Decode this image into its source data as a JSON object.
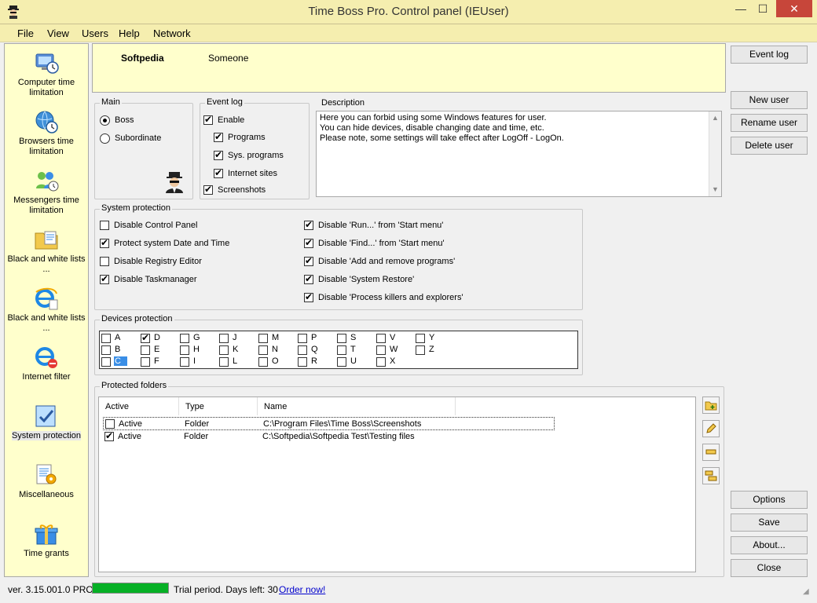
{
  "window": {
    "title": "Time Boss Pro. Control panel (IEUser)"
  },
  "menu": [
    "File",
    "View",
    "Users",
    "Help",
    "Network"
  ],
  "nav": [
    {
      "label": "Computer time limitation",
      "icon": "computer-clock-icon"
    },
    {
      "label": "Browsers time limitation",
      "icon": "globe-clock-icon"
    },
    {
      "label": "Messengers time limitation",
      "icon": "messenger-icon"
    },
    {
      "label": "Black and white lists ...",
      "icon": "folder-list-icon"
    },
    {
      "label": "Black and white lists ...",
      "icon": "ie-list-icon"
    },
    {
      "label": "Internet filter",
      "icon": "ie-filter-icon"
    },
    {
      "label": "System protection",
      "icon": "system-protection-icon"
    },
    {
      "label": "Miscellaneous",
      "icon": "gear-document-icon"
    },
    {
      "label": "Time grants",
      "icon": "gift-icon"
    }
  ],
  "user": {
    "login": "Softpedia",
    "name": "Someone"
  },
  "main": {
    "title": "Main",
    "options": [
      "Boss",
      "Subordinate"
    ],
    "selected": "Boss"
  },
  "eventlog": {
    "title": "Event log",
    "items": [
      {
        "label": "Enable",
        "checked": true
      },
      {
        "label": "Programs",
        "checked": true
      },
      {
        "label": "Sys. programs",
        "checked": true
      },
      {
        "label": "Internet sites",
        "checked": true
      },
      {
        "label": "Screenshots",
        "checked": true
      }
    ]
  },
  "description": {
    "title": "Description",
    "lines": [
      "Here you can forbid using some Windows features for user.",
      "You can hide devices, disable changing date and time, etc.",
      "Please note, some settings will take effect after LogOff - LogOn."
    ]
  },
  "sysprot": {
    "title": "System protection",
    "left": [
      {
        "label": "Disable Control Panel",
        "checked": false
      },
      {
        "label": "Protect system Date and Time",
        "checked": true
      },
      {
        "label": "Disable Registry Editor",
        "checked": false
      },
      {
        "label": "Disable Taskmanager",
        "checked": true
      }
    ],
    "right": [
      {
        "label": "Disable 'Run...' from 'Start menu'",
        "checked": true
      },
      {
        "label": "Disable 'Find...' from 'Start menu'",
        "checked": true
      },
      {
        "label": "Disable 'Add and remove programs'",
        "checked": true
      },
      {
        "label": "Disable 'System Restore'",
        "checked": true
      },
      {
        "label": "Disable 'Process killers and explorers'",
        "checked": true
      }
    ]
  },
  "devices": {
    "title": "Devices protection",
    "columns": [
      [
        "A",
        "B",
        "C"
      ],
      [
        "D",
        "E",
        "F"
      ],
      [
        "G",
        "H",
        "I"
      ],
      [
        "J",
        "K",
        "L"
      ],
      [
        "M",
        "N",
        "O"
      ],
      [
        "P",
        "Q",
        "R"
      ],
      [
        "S",
        "T",
        "U"
      ],
      [
        "V",
        "W",
        "X"
      ],
      [
        "Y",
        "Z"
      ]
    ],
    "checked": [
      "D"
    ],
    "selected": "C"
  },
  "folders": {
    "title": "Protected folders",
    "headers": [
      "Active",
      "Type",
      "Name"
    ],
    "rows": [
      {
        "active": false,
        "status": "Active",
        "type": "Folder",
        "name": "C:\\Program Files\\Time Boss\\Screenshots"
      },
      {
        "active": true,
        "status": "Active",
        "type": "Folder",
        "name": "C:\\Softpedia\\Softpedia Test\\Testing files"
      }
    ],
    "tools": [
      "add-folder-icon",
      "edit-pencil-icon",
      "remove-icon",
      "move-icon"
    ]
  },
  "buttons": {
    "event_log": "Event log",
    "new_user": "New user",
    "rename_user": "Rename user",
    "delete_user": "Delete user",
    "options": "Options",
    "save": "Save",
    "about": "About...",
    "close": "Close"
  },
  "status": {
    "version": "ver. 3.15.001.0 PRO",
    "trial_progress": 1.0,
    "trial_text": "Trial period. Days left: 30",
    "order": "Order now!"
  }
}
